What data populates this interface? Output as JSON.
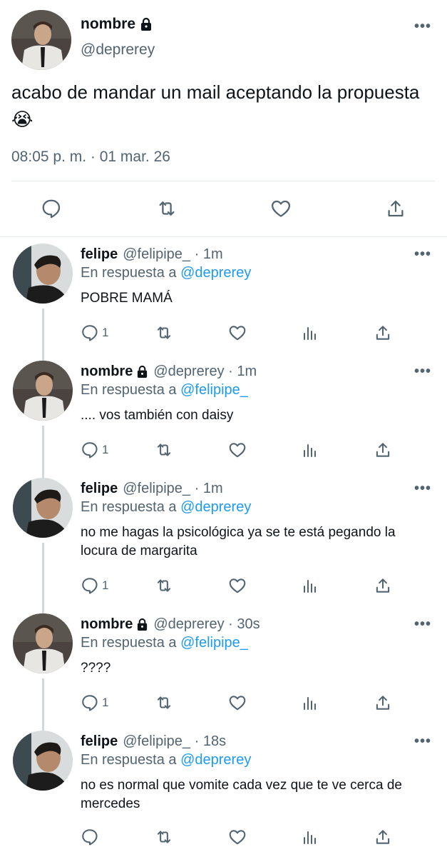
{
  "main_tweet": {
    "author_name": "nombre",
    "author_handle": "@deprerey",
    "text": "acabo de mandar un mail aceptando la propuesta😭",
    "timestamp": "08:05 p. m. · 01 mar. 26"
  },
  "replies": [
    {
      "name": "felipe",
      "handle": "@felipipe_ · 1m",
      "reply_prefix": "En respuesta a ",
      "reply_to": "@deprerey",
      "text": "POBRE MAMÁ",
      "reply_count": "1",
      "locked": false
    },
    {
      "name": "nombre",
      "handle": "@deprerey · 1m",
      "reply_prefix": "En respuesta a ",
      "reply_to": "@felipipe_",
      "text": ".... vos también con daisy",
      "reply_count": "1",
      "locked": true
    },
    {
      "name": "felipe",
      "handle": "@felipipe_ · 1m",
      "reply_prefix": "En respuesta a ",
      "reply_to": "@deprerey",
      "text": "no me hagas la psicológica ya se te está pegando la locura de margarita",
      "reply_count": "1",
      "locked": false
    },
    {
      "name": "nombre",
      "handle": "@deprerey · 30s",
      "reply_prefix": "En respuesta a ",
      "reply_to": "@felipipe_",
      "text": "????",
      "reply_count": "1",
      "locked": true
    },
    {
      "name": "felipe",
      "handle": "@felipipe_ · 18s",
      "reply_prefix": "En respuesta a ",
      "reply_to": "@deprerey",
      "text": "no es normal que vomite cada vez que te ve cerca de mercedes",
      "reply_count": "",
      "locked": false
    }
  ],
  "icons": {
    "more": "more-dots-icon",
    "lock": "lock-icon",
    "reply": "reply-icon",
    "retweet": "retweet-icon",
    "like": "like-icon",
    "share": "share-icon",
    "views": "views-icon"
  },
  "colors": {
    "text": "#0f1419",
    "secondary": "#536471",
    "link": "#1d9bf0",
    "divider": "#e6ecf0",
    "thread_line": "#cfd9de"
  }
}
